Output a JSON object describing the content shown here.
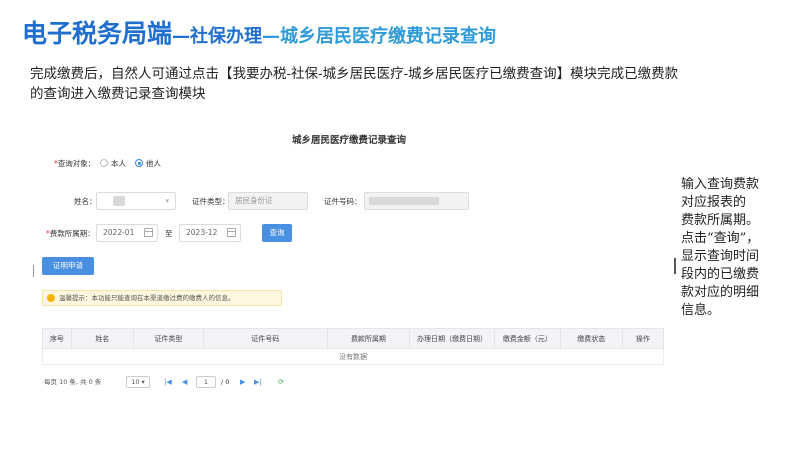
{
  "slide": {
    "title_main": "电子税务局端",
    "title_sep1": "—",
    "title_sub": "社保办理",
    "title_sep2": "—",
    "title_sub2": "城乡居民医疗缴费记录查询",
    "intro": "完成缴费后，自然人可通过点击【我要办税-社保-城乡居民医疗-城乡居民医疗已缴费查询】模块完成已缴费款的查询进入缴费记录查询模块",
    "side_note_lines": [
      "输入查询费款",
      "对应报表的",
      "费款所属期。",
      "点击“查询”，",
      "显示查询时间",
      "段内的已缴费",
      "款对应的明细",
      "信息。"
    ]
  },
  "form": {
    "title": "城乡居民医疗缴费记录查询",
    "query_target_label": "查询对象：",
    "option_self": "本人",
    "option_other": "他人",
    "name_label": "姓名：",
    "id_type_label": "证件类型：",
    "id_type_value": "居民身份证",
    "id_number_label": "证件号码：",
    "period_label": "费款所属期：",
    "period_start": "2022-01",
    "period_to": "至",
    "period_end": "2023-12",
    "query_button": "查询",
    "certificate_button": "证明申请",
    "tip": "温馨提示：本功能只能查询在本渠道缴过费的缴费人的信息。"
  },
  "table": {
    "columns": [
      "序号",
      "姓名",
      "证件类型",
      "证件号码",
      "费款所属期",
      "办理日期（缴费日期）",
      "缴费金额（元）",
      "缴费状态",
      "操作"
    ],
    "empty_text": "没有数据"
  },
  "pager": {
    "summary": "每页 10 条, 共 0 条",
    "page_size": "10",
    "current_page": "1",
    "total_pages": "/ 0"
  },
  "colors": {
    "title": "#1f6fd1",
    "subtitle2": "#2f9bd8",
    "button": "#4a90e2",
    "required": "#e03a3a",
    "tip_bg": "#fff7e0"
  }
}
